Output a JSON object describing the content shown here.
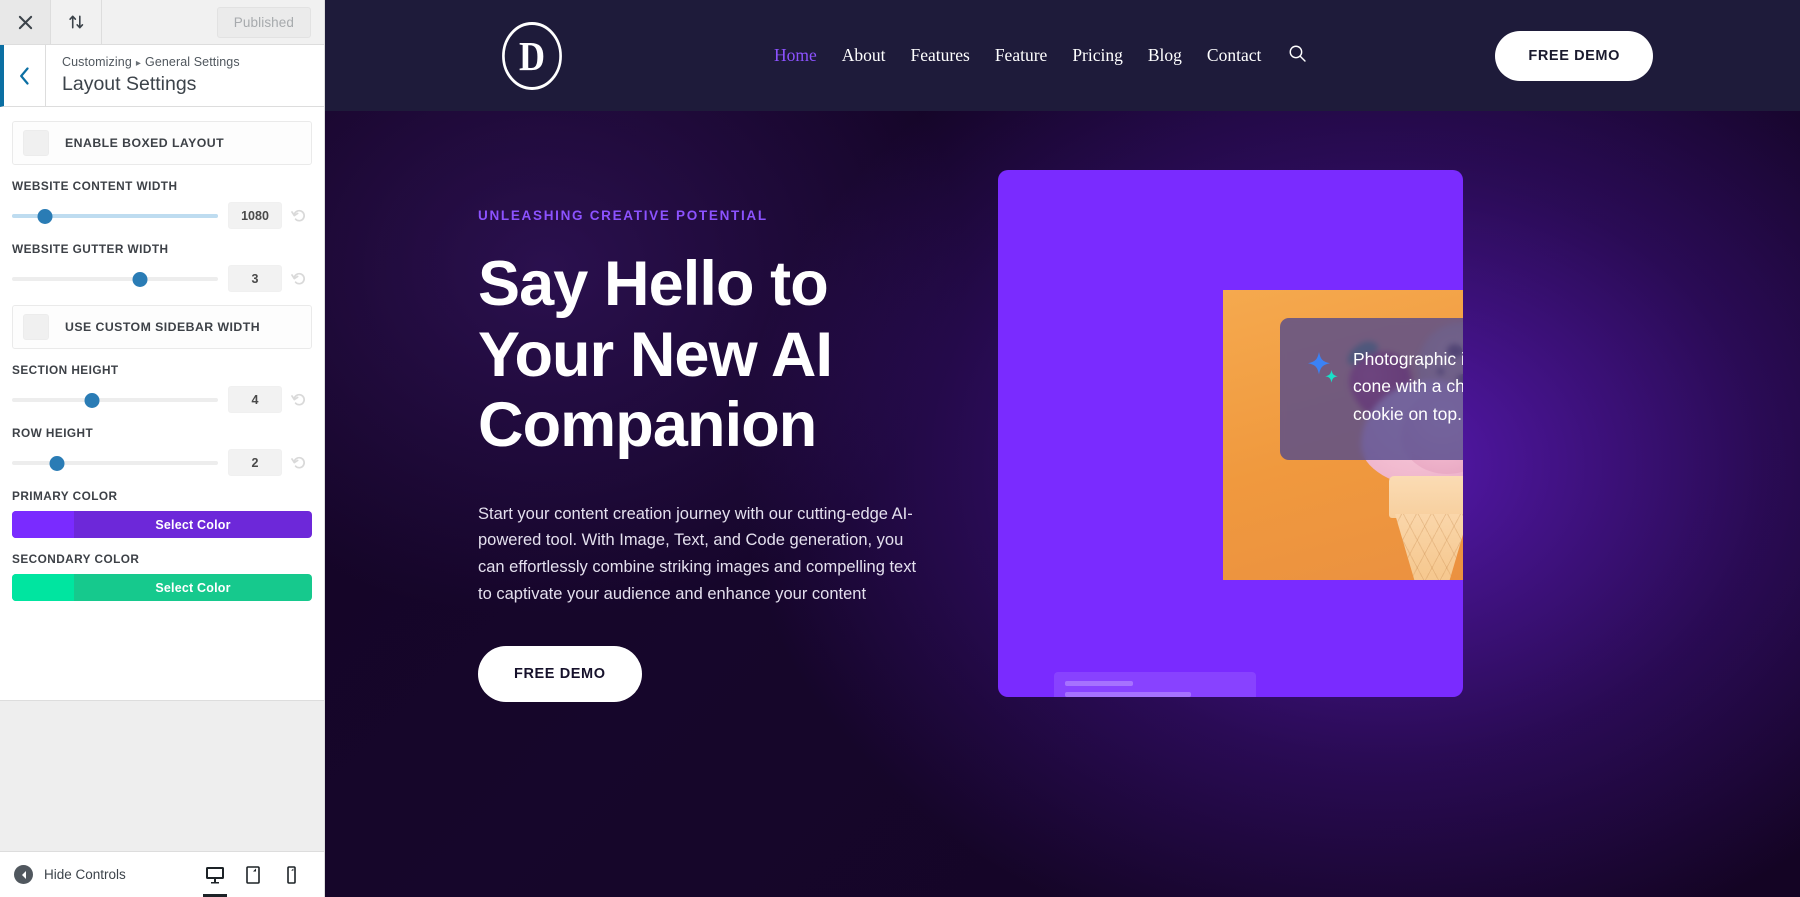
{
  "customizer": {
    "toolbar": {
      "close_icon": "close-icon",
      "collapse_icon": "sort-arrows-icon",
      "status_label": "Published"
    },
    "header": {
      "breadcrumb_root": "Customizing",
      "breadcrumb_sep": "▸",
      "breadcrumb_parent": "General Settings",
      "title": "Layout Settings",
      "back_icon": "chevron-left-icon"
    },
    "controls": [
      {
        "kind": "checkbox",
        "label": "ENABLE BOXED LAYOUT",
        "checked": false
      },
      {
        "kind": "range",
        "label": "WEBSITE CONTENT WIDTH",
        "value": "1080",
        "percent": 16,
        "filled": true,
        "reset_icon": "reset-icon"
      },
      {
        "kind": "range",
        "label": "WEBSITE GUTTER WIDTH",
        "value": "3",
        "percent": 62,
        "filled": false,
        "reset_icon": "reset-icon"
      },
      {
        "kind": "checkbox",
        "label": "USE CUSTOM SIDEBAR WIDTH",
        "checked": false
      },
      {
        "kind": "range",
        "label": "SECTION HEIGHT",
        "value": "4",
        "percent": 39,
        "filled": false,
        "reset_icon": "reset-icon"
      },
      {
        "kind": "range",
        "label": "ROW HEIGHT",
        "value": "2",
        "percent": 22,
        "filled": false,
        "reset_icon": "reset-icon"
      },
      {
        "kind": "color",
        "label": "PRIMARY COLOR",
        "button_label": "Select Color",
        "swatch": "#7a2bff",
        "bar": "#6d28d9"
      },
      {
        "kind": "color",
        "label": "SECONDARY COLOR",
        "button_label": "Select Color",
        "swatch": "#00e5a0",
        "bar": "#16c98d"
      }
    ],
    "footer": {
      "hide_controls_label": "Hide Controls",
      "hide_icon": "collapse-left-icon",
      "devices": [
        {
          "name": "desktop",
          "icon": "desktop-icon",
          "active": true
        },
        {
          "name": "tablet",
          "icon": "tablet-icon",
          "active": false
        },
        {
          "name": "mobile",
          "icon": "mobile-icon",
          "active": false
        }
      ]
    }
  },
  "site": {
    "nav": {
      "logo_letter": "D",
      "logo_name": "divi-logo",
      "items": [
        {
          "label": "Home",
          "active": true
        },
        {
          "label": "About",
          "active": false
        },
        {
          "label": "Features",
          "active": false
        },
        {
          "label": "Feature",
          "active": false
        },
        {
          "label": "Pricing",
          "active": false
        },
        {
          "label": "Blog",
          "active": false
        },
        {
          "label": "Contact",
          "active": false
        }
      ],
      "search_icon": "search-icon",
      "cta_label": "FREE DEMO"
    },
    "hero": {
      "eyebrow": "UNLEASHING CREATIVE POTENTIAL",
      "heading_lines": [
        "Say Hello to",
        "Your New AI",
        "Companion"
      ],
      "paragraph": "Start your content creation journey with our cutting-edge AI-powered tool. With Image, Text, and Code generation, you can effortlessly combine striking images and compelling text to captivate your audience and enhance your content",
      "cta_label": "FREE DEMO",
      "prompt_text": "Photographic ice cream cone with a chocolate chip cookie on top.",
      "sparkle_icon": "sparkle-icon",
      "image_alt": "ice-cream-cone-photo"
    },
    "colors": {
      "nav_bg": "#1e1b3a",
      "accent_purple": "#8c52ff",
      "card_purple": "#7a2bff",
      "photo_orange": "#f0993e"
    }
  }
}
